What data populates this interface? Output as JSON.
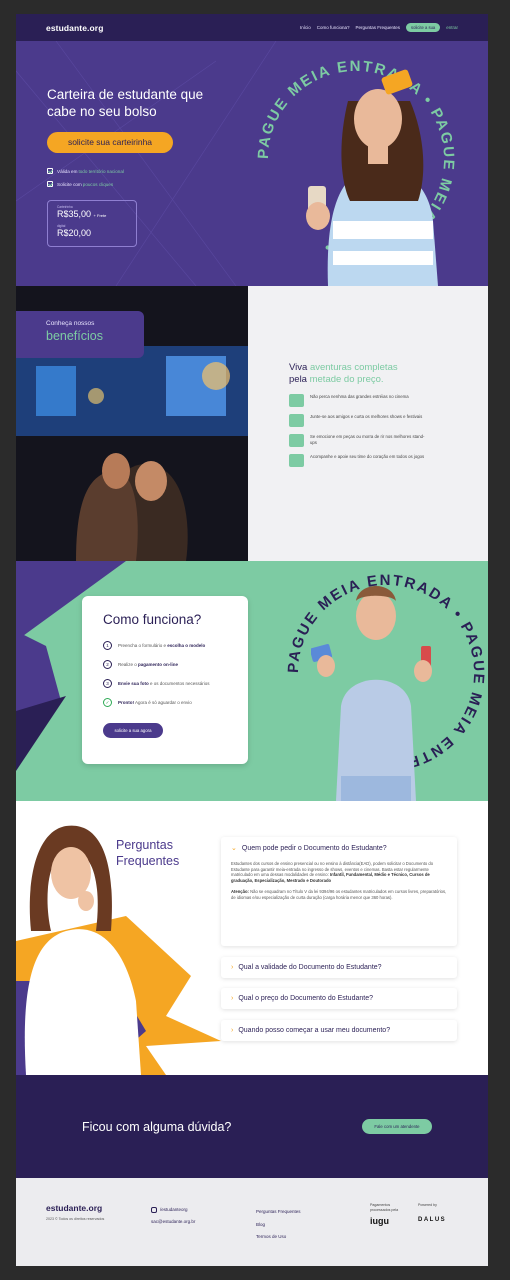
{
  "header": {
    "logo": "estudante.org",
    "nav": [
      "Início",
      "Como funciona?",
      "Perguntas Frequentes"
    ],
    "cta": "solicite a sua",
    "login": "entrar"
  },
  "hero": {
    "title": "Carteira de estudante que cabe no seu bolso",
    "cta": "solicite sua carteirinha",
    "features": [
      {
        "pre": "Válida em ",
        "hl": "todo território nacional"
      },
      {
        "pre": "Solicite com ",
        "hl": "poucos cliques"
      }
    ],
    "price1_label": "Carteirinha",
    "price1": "R$35,00",
    "price1_extra": "+ Frete",
    "price2_label": "digital",
    "price2": "R$20,00",
    "ring_text": "PAGUE MEIA ENTRADA • PAGUE MEIA ENTRADA •"
  },
  "benefits": {
    "tag_small": "Conheça nossos",
    "tag_big": "benefícios",
    "heading_1": "Viva ",
    "heading_hl_1": "aventuras completas",
    "heading_2": "pela ",
    "heading_hl_2": "metade do preço.",
    "items": [
      "Não perca nenhma das grandes estréias no cinema",
      "Junte-se aos amigos e curta os melhores shows e festivais",
      "Se emocione em peças ou morra de rir nos melhores stand-ups",
      "Acompanhe e apoie seu time do coração em todos os jogos"
    ]
  },
  "how": {
    "title": "Como funciona?",
    "steps": [
      {
        "num": "1",
        "pre": "Preencha o formulário e ",
        "b": "escolha o modelo",
        "post": ""
      },
      {
        "num": "2",
        "pre": "Realize o ",
        "b": "pagamento on-line",
        "post": ""
      },
      {
        "num": "3",
        "pre": "",
        "b": "Envie sua foto",
        "post": " e os documentos necessários"
      },
      {
        "num": "✓",
        "pre": "",
        "b": "Pronto!",
        "post": " Agora é só aguardar o envio"
      }
    ],
    "cta": "solicite a sua agora"
  },
  "faq": {
    "title": "Perguntas Frequentes",
    "open_q": "Quem pode pedir o Documento do Estudante?",
    "open_a1": "Estudantes dos cursos de ensino presencial ou no ensino à distância(EAD), podem solicitar o Documento do Estudante para garantir meia-entrada no ingresso de shows, eventos e cinemas. Basta estar regularmente matriculado em uma dessas modalidades de ensino: ",
    "open_a1_b": "Infantil, Fundamental, Médio e Técnico, Cursos de graduação, Especialização, Mestrado e Doutorado",
    "open_a2_b": "Atenção:",
    "open_a2": " Não se enquadram no Título V da lei 9394/96 os estudantes matriculados em cursos livres, preparatórios, de idiomas e/ou especialização de curta duração (carga horária menor que 360 horas).",
    "questions": [
      "Qual a validade do Documento do Estudante?",
      "Qual o preço do Documento do Estudante?",
      "Quando posso começar a usar meu documento?"
    ]
  },
  "contact": {
    "title": "Ficou com alguma dúvida?",
    "cta": "Fale com um atendente"
  },
  "footer": {
    "logo": "estudante.org",
    "copyright": "2023 © Todos os direitos reservados",
    "instagram": "/estudanteorg",
    "email": "sac@estudante.org.br",
    "links": [
      "Perguntas Frequentes",
      "Blog",
      "Termos de Uso"
    ],
    "partner1_label": "Pagamentos processados pela",
    "partner1": "iugu",
    "partner2_label": "Powered by",
    "partner2": "DALUS"
  }
}
